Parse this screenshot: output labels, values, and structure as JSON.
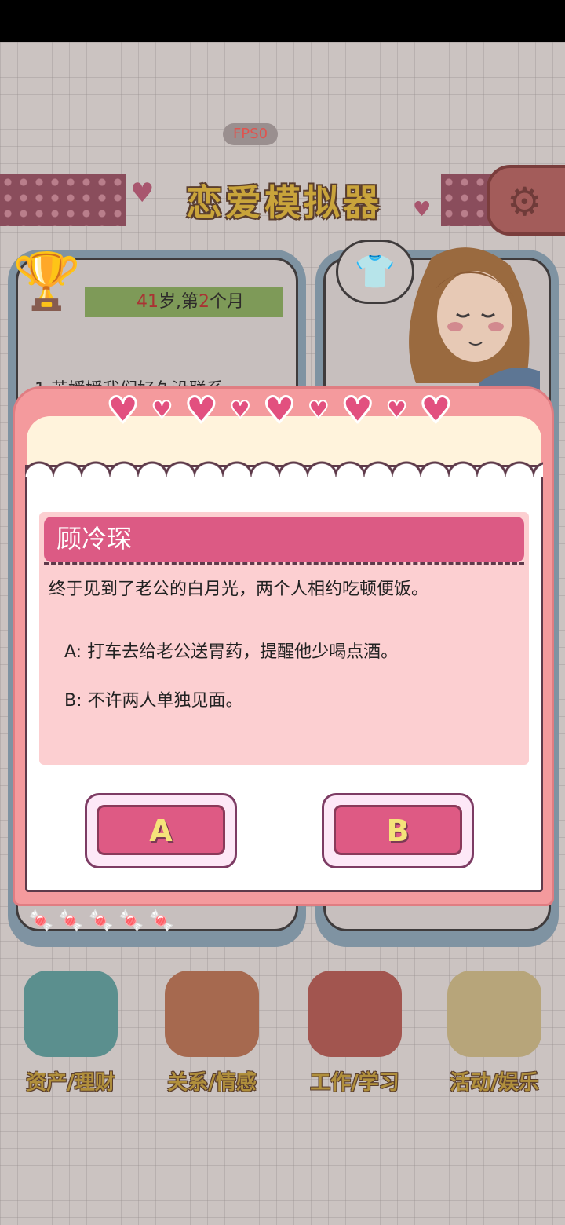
{
  "hud": {
    "fps": "FPS0",
    "title": "恋爱模拟器",
    "settings_icon": "gear-icon",
    "age_number": "41",
    "age_mid": "岁,第",
    "month_number": "2",
    "age_suffix": "个月",
    "background_story": "1.英媛媛我们好久没联系"
  },
  "menu": [
    {
      "label": "资产/理财",
      "icon": "piggy-bank-icon"
    },
    {
      "label": "关系/情感",
      "icon": "coffee-cups-icon"
    },
    {
      "label": "工作/学习",
      "icon": "notebook-icon"
    },
    {
      "label": "活动/娱乐",
      "icon": "popcorn-icon"
    }
  ],
  "dialog": {
    "name": "顾冷琛",
    "story": "终于见到了老公的白月光，两个人相约吃顿便饭。",
    "option_a": "A: 打车去给老公送胃药，提醒他少喝点酒。",
    "option_b": "B: 不许两人单独见面。",
    "button_a": "A",
    "button_b": "B"
  },
  "colors": {
    "dialog_pink": "#f49a9d",
    "name_bar": "#dc5a84",
    "button_face": "#de5a84",
    "button_text": "#f5e37a"
  }
}
